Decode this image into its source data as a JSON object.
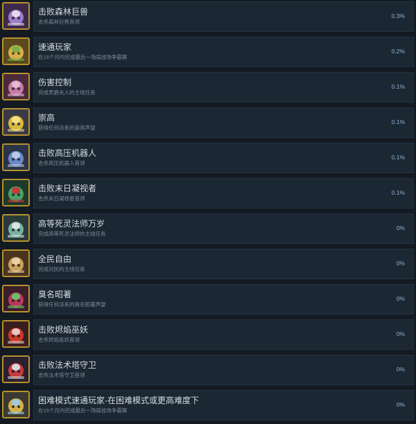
{
  "achievements": [
    {
      "title": "击败森林巨兽",
      "desc": "击杀森林巨兽首领",
      "percent": "0.3%",
      "icon": "forest-beast-icon",
      "colors": [
        "#3d2a4a",
        "#9a7ec8",
        "#e6d8f0"
      ]
    },
    {
      "title": "速通玩家",
      "desc": "在15个月内完成最后一场局技场争霸赛",
      "percent": "0.2%",
      "icon": "speedrun-icon",
      "colors": [
        "#5a4a1e",
        "#d6b04a",
        "#7ab04a"
      ]
    },
    {
      "title": "伤害控制",
      "desc": "完成男爵夫人的主线任务",
      "percent": "0.1%",
      "icon": "damage-control-icon",
      "colors": [
        "#4a2a3a",
        "#c47aa8",
        "#e8b8d4"
      ]
    },
    {
      "title": "崇高",
      "desc": "获得任何派系的崇高声望",
      "percent": "0.1%",
      "icon": "crown-icon",
      "colors": [
        "#3a3a46",
        "#d8b83a",
        "#f4e08a"
      ]
    },
    {
      "title": "击败高压机器人",
      "desc": "击杀高压机器人首领",
      "percent": "0.1%",
      "icon": "robot-icon",
      "colors": [
        "#2a3448",
        "#6a8ac8",
        "#b8c8e8"
      ]
    },
    {
      "title": "击败末日凝视者",
      "desc": "击杀末日凝视者首领",
      "percent": "0.1%",
      "icon": "gazer-icon",
      "colors": [
        "#1e3a2a",
        "#4aa06a",
        "#c83a3a"
      ]
    },
    {
      "title": "高等死灵法师万岁",
      "desc": "完成高等死灵法师的主线任务",
      "percent": "0%",
      "icon": "necromancer-icon",
      "colors": [
        "#2a3a3a",
        "#7ab0a0",
        "#d4e8e0"
      ]
    },
    {
      "title": "全民自由",
      "desc": "完成对民的主线任务",
      "percent": "0%",
      "icon": "scroll-icon",
      "colors": [
        "#4a3420",
        "#c8a060",
        "#e8d0a0"
      ]
    },
    {
      "title": "臭名昭著",
      "desc": "获得任何派系的臭名昭著声望",
      "percent": "0%",
      "icon": "infamous-icon",
      "colors": [
        "#3a1e2a",
        "#b83a5a",
        "#6ac06a"
      ]
    },
    {
      "title": "击败烬焰巫妖",
      "desc": "击杀烬焰巫妖首领",
      "percent": "0%",
      "icon": "lich-icon",
      "colors": [
        "#3a1e1e",
        "#c83a2a",
        "#e8c8c8"
      ]
    },
    {
      "title": "击败法术塔守卫",
      "desc": "击杀法术塔守卫首领",
      "percent": "0%",
      "icon": "tower-guard-icon",
      "colors": [
        "#2a2030",
        "#c83a3a",
        "#d8d8e0"
      ]
    },
    {
      "title": "困难模式速通玩家-在困难模式或更高难度下",
      "desc": "在15个月内完成最后一场局技场争霸赛",
      "percent": "0%",
      "icon": "hard-speedrun-icon",
      "colors": [
        "#3a3a30",
        "#d6b04a",
        "#a0c8e0"
      ]
    }
  ]
}
